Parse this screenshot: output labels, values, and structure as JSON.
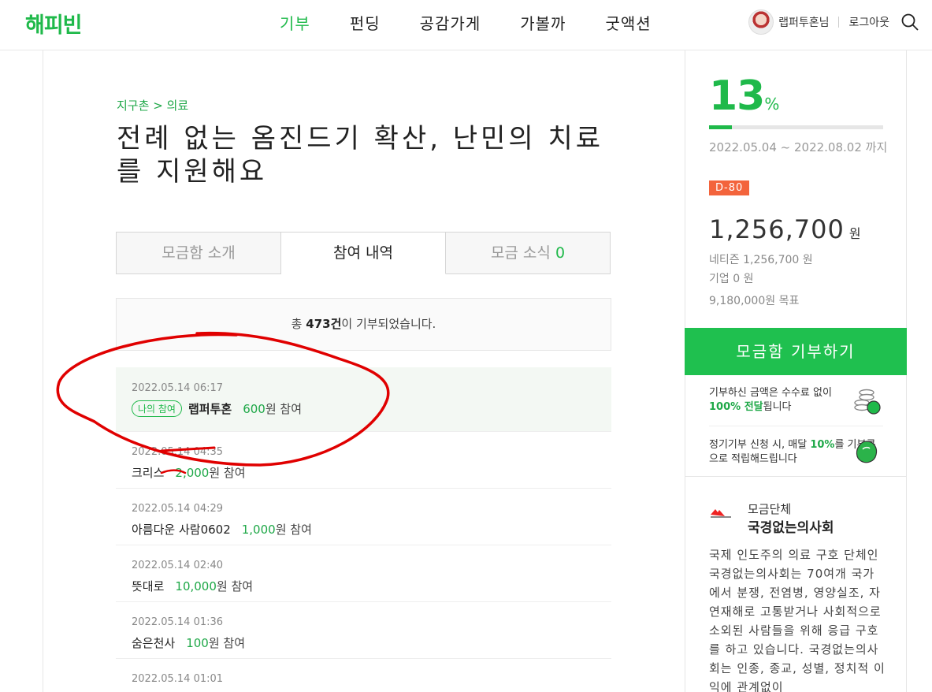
{
  "header": {
    "logo": "해피빈",
    "nav": [
      "기부",
      "펀딩",
      "공감가게",
      "가볼까",
      "굿액션"
    ],
    "user_name": "랩퍼투혼님",
    "logout": "로그아웃"
  },
  "campaign": {
    "breadcrumb_category": "지구촌",
    "breadcrumb_sep": ">",
    "breadcrumb_sub": "의료",
    "title": "전례 없는 옴진드기 확산, 난민의 치료를 지원해요"
  },
  "tabs": {
    "intro": "모금함 소개",
    "history": "참여 내역",
    "news": "모금 소식",
    "news_count": "0"
  },
  "total": {
    "prefix": "총",
    "count": "473건",
    "suffix": "이 기부되었습니다."
  },
  "donations": [
    {
      "date": "2022.05.14 06:17",
      "badge": "나의 참여",
      "donor": "랩퍼투혼",
      "amount": "600",
      "unit": "원 참여"
    },
    {
      "date": "2022.05.14 04:35",
      "donor": "크리스",
      "amount": "2,000",
      "unit": "원 참여"
    },
    {
      "date": "2022.05.14 04:29",
      "donor": "아름다운 사람0602",
      "amount": "1,000",
      "unit": "원 참여"
    },
    {
      "date": "2022.05.14 02:40",
      "donor": "뜻대로",
      "amount": "10,000",
      "unit": "원 참여"
    },
    {
      "date": "2022.05.14 01:36",
      "donor": "숨은천사",
      "amount": "100",
      "unit": "원 참여"
    },
    {
      "date": "2022.05.14 01:01"
    }
  ],
  "summary": {
    "percent": "13",
    "percent_sign": "%",
    "progress": 0.13,
    "period": "2022.05.04 ~ 2022.08.02 까지",
    "dday": "D-80",
    "amount": "1,256,700",
    "amount_unit": "원",
    "netizen": "네티즌 1,256,700 원",
    "company": "기업 0 원",
    "goal": "9,180,000원 목표",
    "donate_button": "모금함 기부하기",
    "benefit1_pre": "기부하신 금액은 수수료 없이",
    "benefit1_bold": "100% 전달",
    "benefit1_post": "됩니다",
    "benefit2_pre": "정기기부 신청 시, 매달",
    "benefit2_bold": "10%",
    "benefit2_post": "를 기부콩으로 적립해드립니다"
  },
  "organization": {
    "label": "모금단체",
    "name": "국경없는의사회",
    "description": "국제 인도주의 의료 구호 단체인 국경없는의사회는 70여개 국가에서 분쟁, 전염병, 영양실조, 자연재해로 고통받거나 사회적으로 소외된 사람들을 위해 응급 구호를 하고 있습니다. 국경없는의사회는 인종, 종교, 성별, 정치적 이익에 관계없이"
  },
  "colors": {
    "brand_green": "#1fb94a",
    "dday_orange": "#f3643c",
    "annotation_red": "#e00000"
  }
}
